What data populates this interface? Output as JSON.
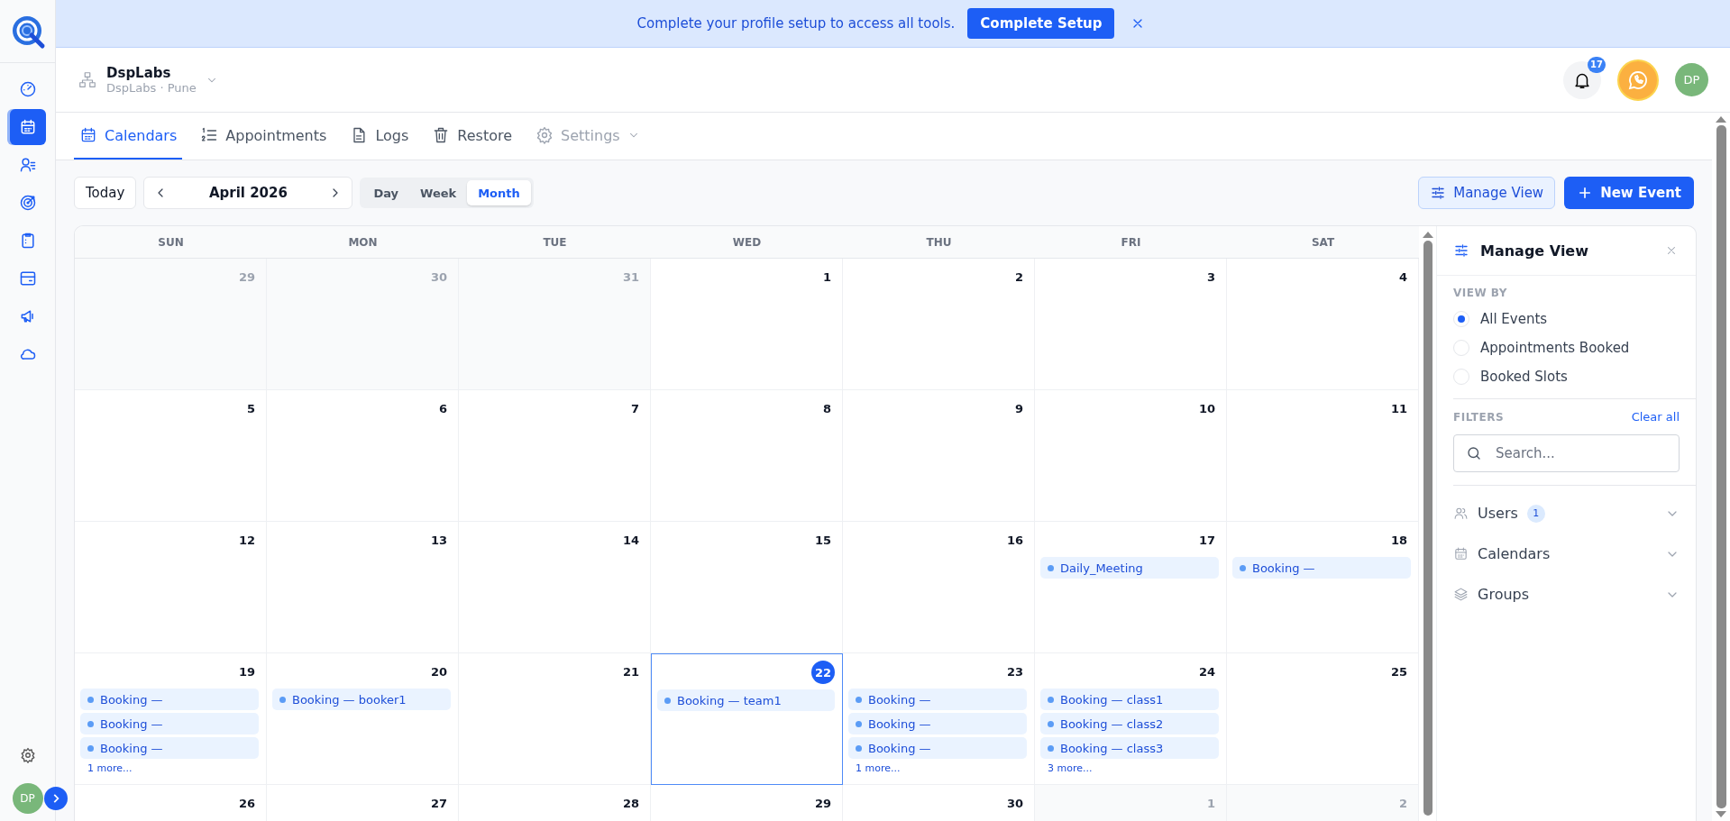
{
  "banner": {
    "message": "Complete your profile setup to access all tools.",
    "button": "Complete Setup"
  },
  "sidebar": {
    "items": [
      {
        "selected": false
      },
      {
        "selected": true
      },
      {
        "selected": false
      },
      {
        "selected": false
      },
      {
        "selected": false
      },
      {
        "selected": false
      },
      {
        "selected": false
      },
      {
        "selected": false
      }
    ],
    "avatar": "DP"
  },
  "header": {
    "org_name": "DspLabs",
    "org_location": "DspLabs · Pune",
    "notification_count": "17",
    "avatar": "DP"
  },
  "tabs": [
    {
      "label": "Calendars",
      "selected": true,
      "disabled": false
    },
    {
      "label": "Appointments",
      "selected": false,
      "disabled": false
    },
    {
      "label": "Logs",
      "selected": false,
      "disabled": false
    },
    {
      "label": "Restore",
      "selected": false,
      "disabled": false
    },
    {
      "label": "Settings",
      "selected": false,
      "disabled": true
    }
  ],
  "toolbar": {
    "today": "Today",
    "period": "April 2026",
    "views": [
      {
        "label": "Day",
        "selected": false
      },
      {
        "label": "Week",
        "selected": false
      },
      {
        "label": "Month",
        "selected": true
      }
    ],
    "manage_view": "Manage View",
    "new_event": "New Event"
  },
  "calendar": {
    "weekdays": [
      "SUN",
      "MON",
      "TUE",
      "WED",
      "THU",
      "FRI",
      "SAT"
    ],
    "weeks": [
      {
        "days": [
          {
            "date": "29",
            "other_month": true,
            "today": false
          },
          {
            "date": "30",
            "other_month": true,
            "today": false
          },
          {
            "date": "31",
            "other_month": true,
            "today": false
          },
          {
            "date": "1",
            "other_month": false,
            "today": false
          },
          {
            "date": "2",
            "other_month": false,
            "today": false
          },
          {
            "date": "3",
            "other_month": false,
            "today": false
          },
          {
            "date": "4",
            "other_month": false,
            "today": false
          }
        ]
      },
      {
        "days": [
          {
            "date": "5",
            "other_month": false,
            "today": false
          },
          {
            "date": "6",
            "other_month": false,
            "today": false
          },
          {
            "date": "7",
            "other_month": false,
            "today": false
          },
          {
            "date": "8",
            "other_month": false,
            "today": false
          },
          {
            "date": "9",
            "other_month": false,
            "today": false
          },
          {
            "date": "10",
            "other_month": false,
            "today": false
          },
          {
            "date": "11",
            "other_month": false,
            "today": false
          }
        ]
      },
      {
        "days": [
          {
            "date": "12",
            "other_month": false,
            "today": false
          },
          {
            "date": "13",
            "other_month": false,
            "today": false
          },
          {
            "date": "14",
            "other_month": false,
            "today": false
          },
          {
            "date": "15",
            "other_month": false,
            "today": false
          },
          {
            "date": "16",
            "other_month": false,
            "today": false
          },
          {
            "date": "17",
            "other_month": false,
            "today": false,
            "events": [
              "Daily_Meeting"
            ]
          },
          {
            "date": "18",
            "other_month": false,
            "today": false,
            "events": [
              "Booking —"
            ]
          }
        ]
      },
      {
        "days": [
          {
            "date": "19",
            "other_month": false,
            "today": false,
            "events": [
              "Booking —",
              "Booking —",
              "Booking —"
            ],
            "more": "1 more..."
          },
          {
            "date": "20",
            "other_month": false,
            "today": false,
            "events": [
              "Booking — booker1"
            ]
          },
          {
            "date": "21",
            "other_month": false,
            "today": false
          },
          {
            "date": "22",
            "other_month": false,
            "today": true,
            "events": [
              "Booking — team1"
            ]
          },
          {
            "date": "23",
            "other_month": false,
            "today": false,
            "events": [
              "Booking —",
              "Booking —",
              "Booking —"
            ],
            "more": "1 more..."
          },
          {
            "date": "24",
            "other_month": false,
            "today": false,
            "events": [
              "Booking — class1",
              "Booking — class2",
              "Booking — class3"
            ],
            "more": "3 more..."
          },
          {
            "date": "25",
            "other_month": false,
            "today": false
          }
        ]
      },
      {
        "days": [
          {
            "date": "26",
            "other_month": false,
            "today": false
          },
          {
            "date": "27",
            "other_month": false,
            "today": false
          },
          {
            "date": "28",
            "other_month": false,
            "today": false
          },
          {
            "date": "29",
            "other_month": false,
            "today": false
          },
          {
            "date": "30",
            "other_month": false,
            "today": false
          },
          {
            "date": "1",
            "other_month": true,
            "today": false
          },
          {
            "date": "2",
            "other_month": true,
            "today": false
          }
        ]
      }
    ]
  },
  "manage_panel": {
    "title": "Manage View",
    "view_by_label": "VIEW BY",
    "options": [
      {
        "label": "All Events",
        "selected": true
      },
      {
        "label": "Appointments Booked",
        "selected": false
      },
      {
        "label": "Booked Slots",
        "selected": false
      }
    ],
    "filters_label": "FILTERS",
    "clear_all": "Clear all",
    "search_placeholder": "Search...",
    "sections": [
      {
        "label": "Users",
        "badge": "1"
      },
      {
        "label": "Calendars"
      },
      {
        "label": "Groups"
      }
    ]
  }
}
